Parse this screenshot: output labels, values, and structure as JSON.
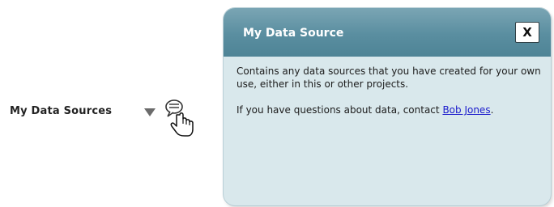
{
  "sidebar": {
    "item_label": "My Data Sources"
  },
  "icons": {
    "dropdown": "chevron-down-icon",
    "info": "info-pointer-icon"
  },
  "popup": {
    "title": "My Data Source",
    "close_label": "X",
    "description": "Contains any data sources that you have created for your own use, either in this or other projects.",
    "contact_prefix": "If you have questions about data, contact ",
    "contact_name": "Bob Jones",
    "contact_suffix": "."
  },
  "colors": {
    "header": "#5a8ea0",
    "body": "#d9e8ec",
    "link": "#1a1acc"
  }
}
